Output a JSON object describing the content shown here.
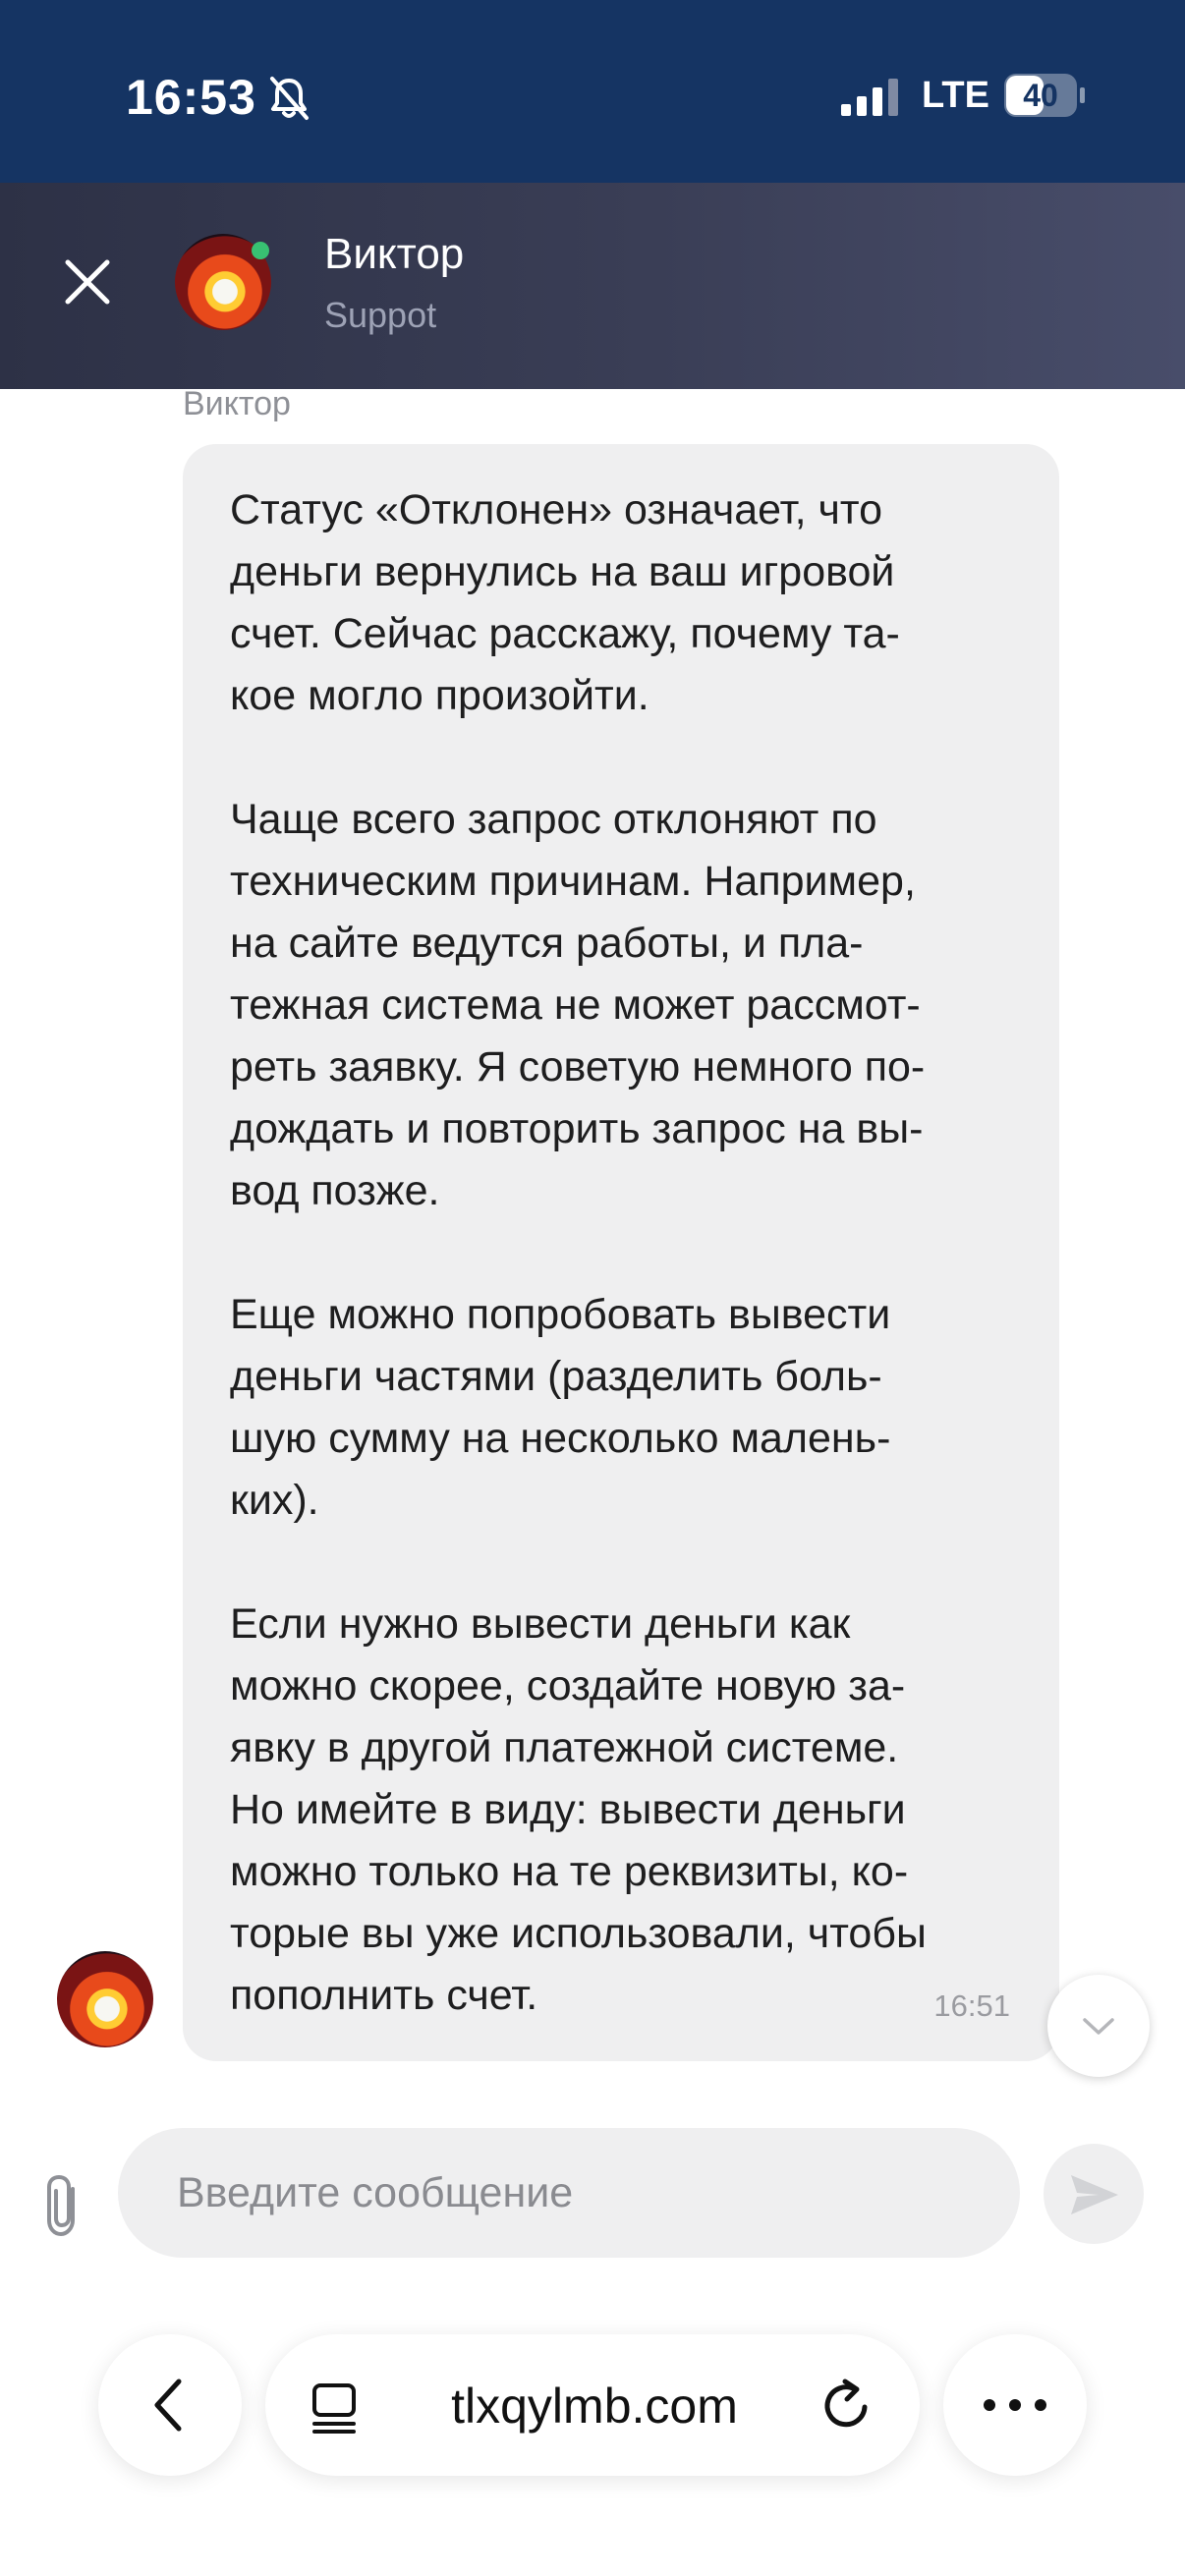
{
  "status_bar": {
    "time": "16:53",
    "network": "LTE",
    "battery": "40",
    "icons": [
      "bell-muted-icon",
      "signal-icon",
      "battery-icon"
    ]
  },
  "header": {
    "agent_name": "Виктор",
    "agent_role": "Suppot",
    "online": true,
    "icons": [
      "close-icon",
      "avatar"
    ]
  },
  "message": {
    "sender": "Виктор",
    "text": "Статус «Отклонен» означает, что\nденьги вернулись на ваш игровой\nсчет. Сейчас расскажу, почему та-\nкое могло произойти.\n\nЧаще всего запрос отклоняют по\nтехническим причинам. Например,\nна сайте ведутся работы, и пла-\nтежная система не может рассмот-\nреть заявку. Я советую немного по-\nдождать и повторить запрос на вы-\nвод позже.\n\nЕще можно попробовать вывести\nденьги частями (разделить боль-\nшую сумму на несколько малень-\nких).\n\nЕсли нужно вывести деньги как\nможно скорее, создайте новую за-\nявку в другой платежной системе.\nНо имейте в виду: вывести деньги\nможно только на те реквизиты, ко-\nторые вы уже использовали, чтобы\nпополнить счет.",
    "time": "16:51"
  },
  "composer": {
    "placeholder": "Введите сообщение",
    "icons": [
      "paperclip-icon",
      "send-icon",
      "chevron-down-icon"
    ]
  },
  "browser": {
    "url": "tlxqylmb.com",
    "icons": [
      "back-icon",
      "tabs-icon",
      "reload-icon",
      "more-icon"
    ]
  },
  "colors": {
    "status_bar_bg": "#153463",
    "header_bg": "#3a3e56",
    "bubble_bg": "#efeff0",
    "online_dot": "#38c172"
  }
}
